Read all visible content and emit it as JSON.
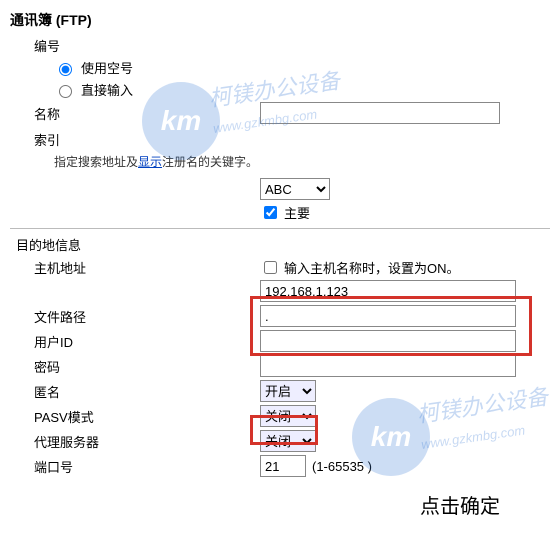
{
  "title": "通讯簿 (FTP)",
  "numbering": {
    "label": "编号",
    "opt_empty": "使用空号",
    "opt_direct": "直接输入"
  },
  "name_label": "名称",
  "name_value": "",
  "index": {
    "label": "索引",
    "hint_pre": "指定搜索地址及",
    "hint_link": "显示",
    "hint_post": "注册名的关键字。",
    "dropdown": "ABC",
    "main_cb": "主要"
  },
  "dest": {
    "section": "目的地信息",
    "host_label": "主机地址",
    "host_cb_text": "输入主机名称时，设置为ON。",
    "host_value": "192.168.1.123",
    "path_label": "文件路径",
    "path_value": ".",
    "user_label": "用户ID",
    "user_value": "",
    "pwd_label": "密码",
    "pwd_value": "",
    "anon_label": "匿名",
    "anon_value": "开启",
    "pasv_label": "PASV模式",
    "pasv_value": "关闭",
    "proxy_label": "代理服务器",
    "proxy_value": "关闭",
    "port_label": "端口号",
    "port_value": "21",
    "port_range": "(1-65535 )"
  },
  "annotation": "点击确定",
  "watermark_text": "柯镁办公设备",
  "watermark_url": "www.gzkmbg.com"
}
